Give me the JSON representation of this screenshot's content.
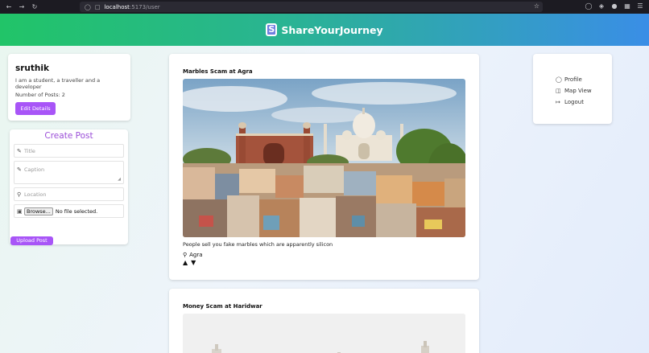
{
  "browser": {
    "url_host": "localhost",
    "url_path": ":5173/user"
  },
  "header": {
    "logo_letter": "S",
    "title": "ShareYourJourney"
  },
  "profile": {
    "name": "sruthik",
    "bio": "I am a student, a traveller and a developer",
    "posts_count": "Number of Posts: 2",
    "edit_label": "Edit Details"
  },
  "create_post": {
    "heading": "Create Post",
    "title_placeholder": "Title",
    "caption_placeholder": "Caption",
    "location_placeholder": "Location",
    "browse_label": "Browse...",
    "file_status": "No file selected.",
    "upload_label": "Upload Post"
  },
  "posts": [
    {
      "title": "Marbles Scam at Agra",
      "caption": "People sell you fake marbles which are apparently silicon",
      "location": "Agra"
    },
    {
      "title": "Money Scam at Haridwar"
    }
  ],
  "menu": {
    "items": [
      {
        "label": "Profile",
        "icon": "user-icon"
      },
      {
        "label": "Map View",
        "icon": "map-icon"
      },
      {
        "label": "Logout",
        "icon": "logout-icon"
      }
    ]
  },
  "colors": {
    "accent": "#a855f7",
    "header_start": "#21c468",
    "header_end": "#3a8ee6"
  }
}
